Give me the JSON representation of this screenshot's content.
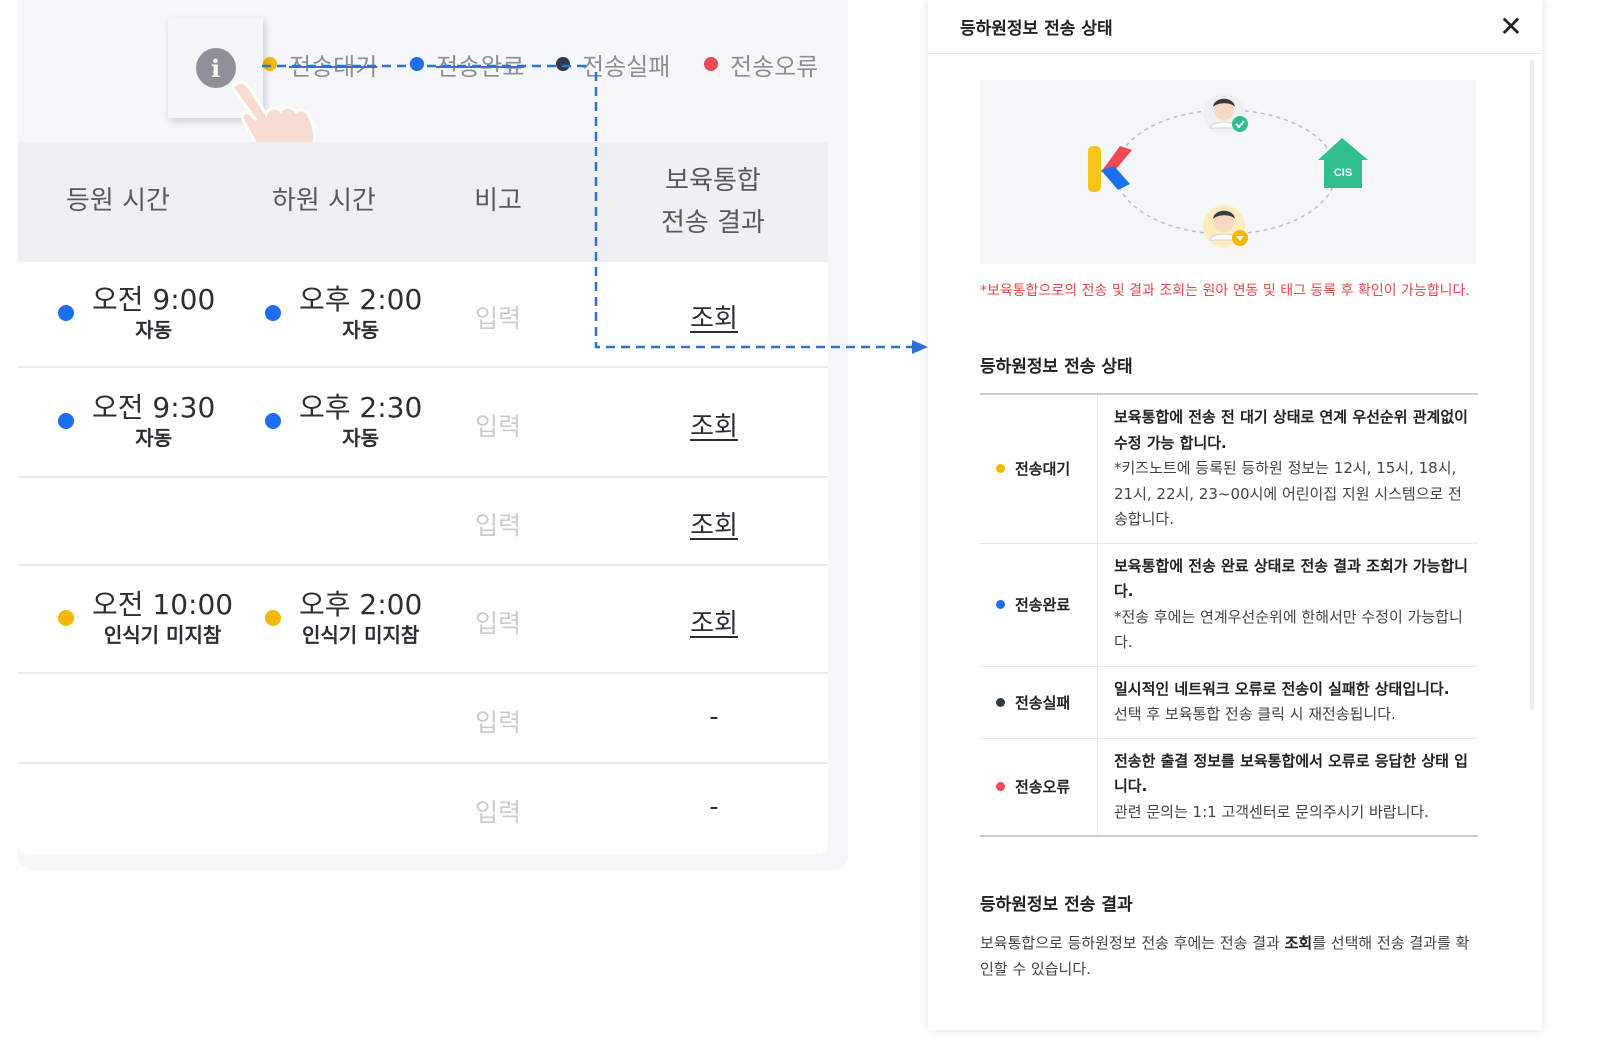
{
  "legend": {
    "items": [
      {
        "label": "전송대기",
        "color": "#f5b800",
        "struck": true
      },
      {
        "label": "전송완료",
        "color": "#1d6ff2",
        "struck": true
      },
      {
        "label": "전송실패",
        "color": "#2f3a4a",
        "struck": false
      },
      {
        "label": "전송오류",
        "color": "#ef4a55",
        "struck": false
      }
    ],
    "info_icon": "i"
  },
  "table": {
    "headers": {
      "checkin": "등원 시간",
      "checkout": "하원 시간",
      "note": "비고",
      "result_line1": "보육통합",
      "result_line2": "전송 결과"
    },
    "rows": [
      {
        "checkin": {
          "time": "오전 9:00",
          "sub": "자동",
          "color": "#1d6ff2"
        },
        "checkout": {
          "time": "오후 2:00",
          "sub": "자동",
          "color": "#1d6ff2"
        },
        "note": "입력",
        "result": "조회",
        "result_link": true
      },
      {
        "checkin": {
          "time": "오전 9:30",
          "sub": "자동",
          "color": "#1d6ff2"
        },
        "checkout": {
          "time": "오후 2:30",
          "sub": "자동",
          "color": "#1d6ff2"
        },
        "note": "입력",
        "result": "조회",
        "result_link": true
      },
      {
        "checkin": null,
        "checkout": null,
        "note": "입력",
        "result": "조회",
        "result_link": true
      },
      {
        "checkin": {
          "time": "오전 10:00",
          "sub": "인식기 미지참",
          "color": "#f5b800"
        },
        "checkout": {
          "time": "오후 2:00",
          "sub": "인식기 미지참",
          "color": "#f5b800"
        },
        "note": "입력",
        "result": "조회",
        "result_link": true
      },
      {
        "checkin": null,
        "checkout": null,
        "note": "입력",
        "result": "-",
        "result_link": false
      },
      {
        "checkin": null,
        "checkout": null,
        "note": "입력",
        "result": "-",
        "result_link": false
      }
    ]
  },
  "modal": {
    "title": "등하원정보 전송 상태",
    "close": "✕",
    "illustration": {
      "logo_letter": "K",
      "house_label": "CIS"
    },
    "notice": "*보육통합으로의 전송 및 결과 조회는 원아 연동 및 태그 등록 후 확인이 가능합니다.",
    "status_section_title": "등하원정보 전송 상태",
    "statuses": [
      {
        "label": "전송대기",
        "color": "#f5b800",
        "desc_main": "보육통합에 전송 전 대기 상태로 연계 우선순위 관계없이 수정 가능 합니다.",
        "desc_sub": "*키즈노트에 등록된 등하원 정보는 12시, 15시, 18시, 21시, 22시, 23~00시에 어린이집 지원 시스템으로 전송합니다."
      },
      {
        "label": "전송완료",
        "color": "#1d6ff2",
        "desc_main": "보육통합에 전송 완료 상태로 전송 결과 조회가 가능합니다.",
        "desc_sub": "*전송 후에는 연계우선순위에 한해서만 수정이 가능합니다."
      },
      {
        "label": "전송실패",
        "color": "#2f3a4a",
        "desc_main": "일시적인 네트워크 오류로 전송이 실패한 상태입니다.",
        "desc_sub": "선택 후 보육통합 전송 클릭 시 재전송됩니다."
      },
      {
        "label": "전송오류",
        "color": "#ef4a55",
        "desc_main": "전송한 출결 정보를 보육통합에서 오류로 응답한 상태 입니다.",
        "desc_sub": "관련 문의는 1:1 고객센터로 문의주시기 바랍니다."
      }
    ],
    "result_section_title": "등하원정보 전송 결과",
    "result_text_pre": "보육통합으로 등하원정보 전송 후에는 전송 결과 ",
    "result_text_bold": "조회",
    "result_text_post": "를 선택해 전송 결과를 확인할 수 있습니다."
  },
  "colors": {
    "accent": "#1d6ff2",
    "connector": "#2f6fd6",
    "house": "#2fbf8f"
  }
}
